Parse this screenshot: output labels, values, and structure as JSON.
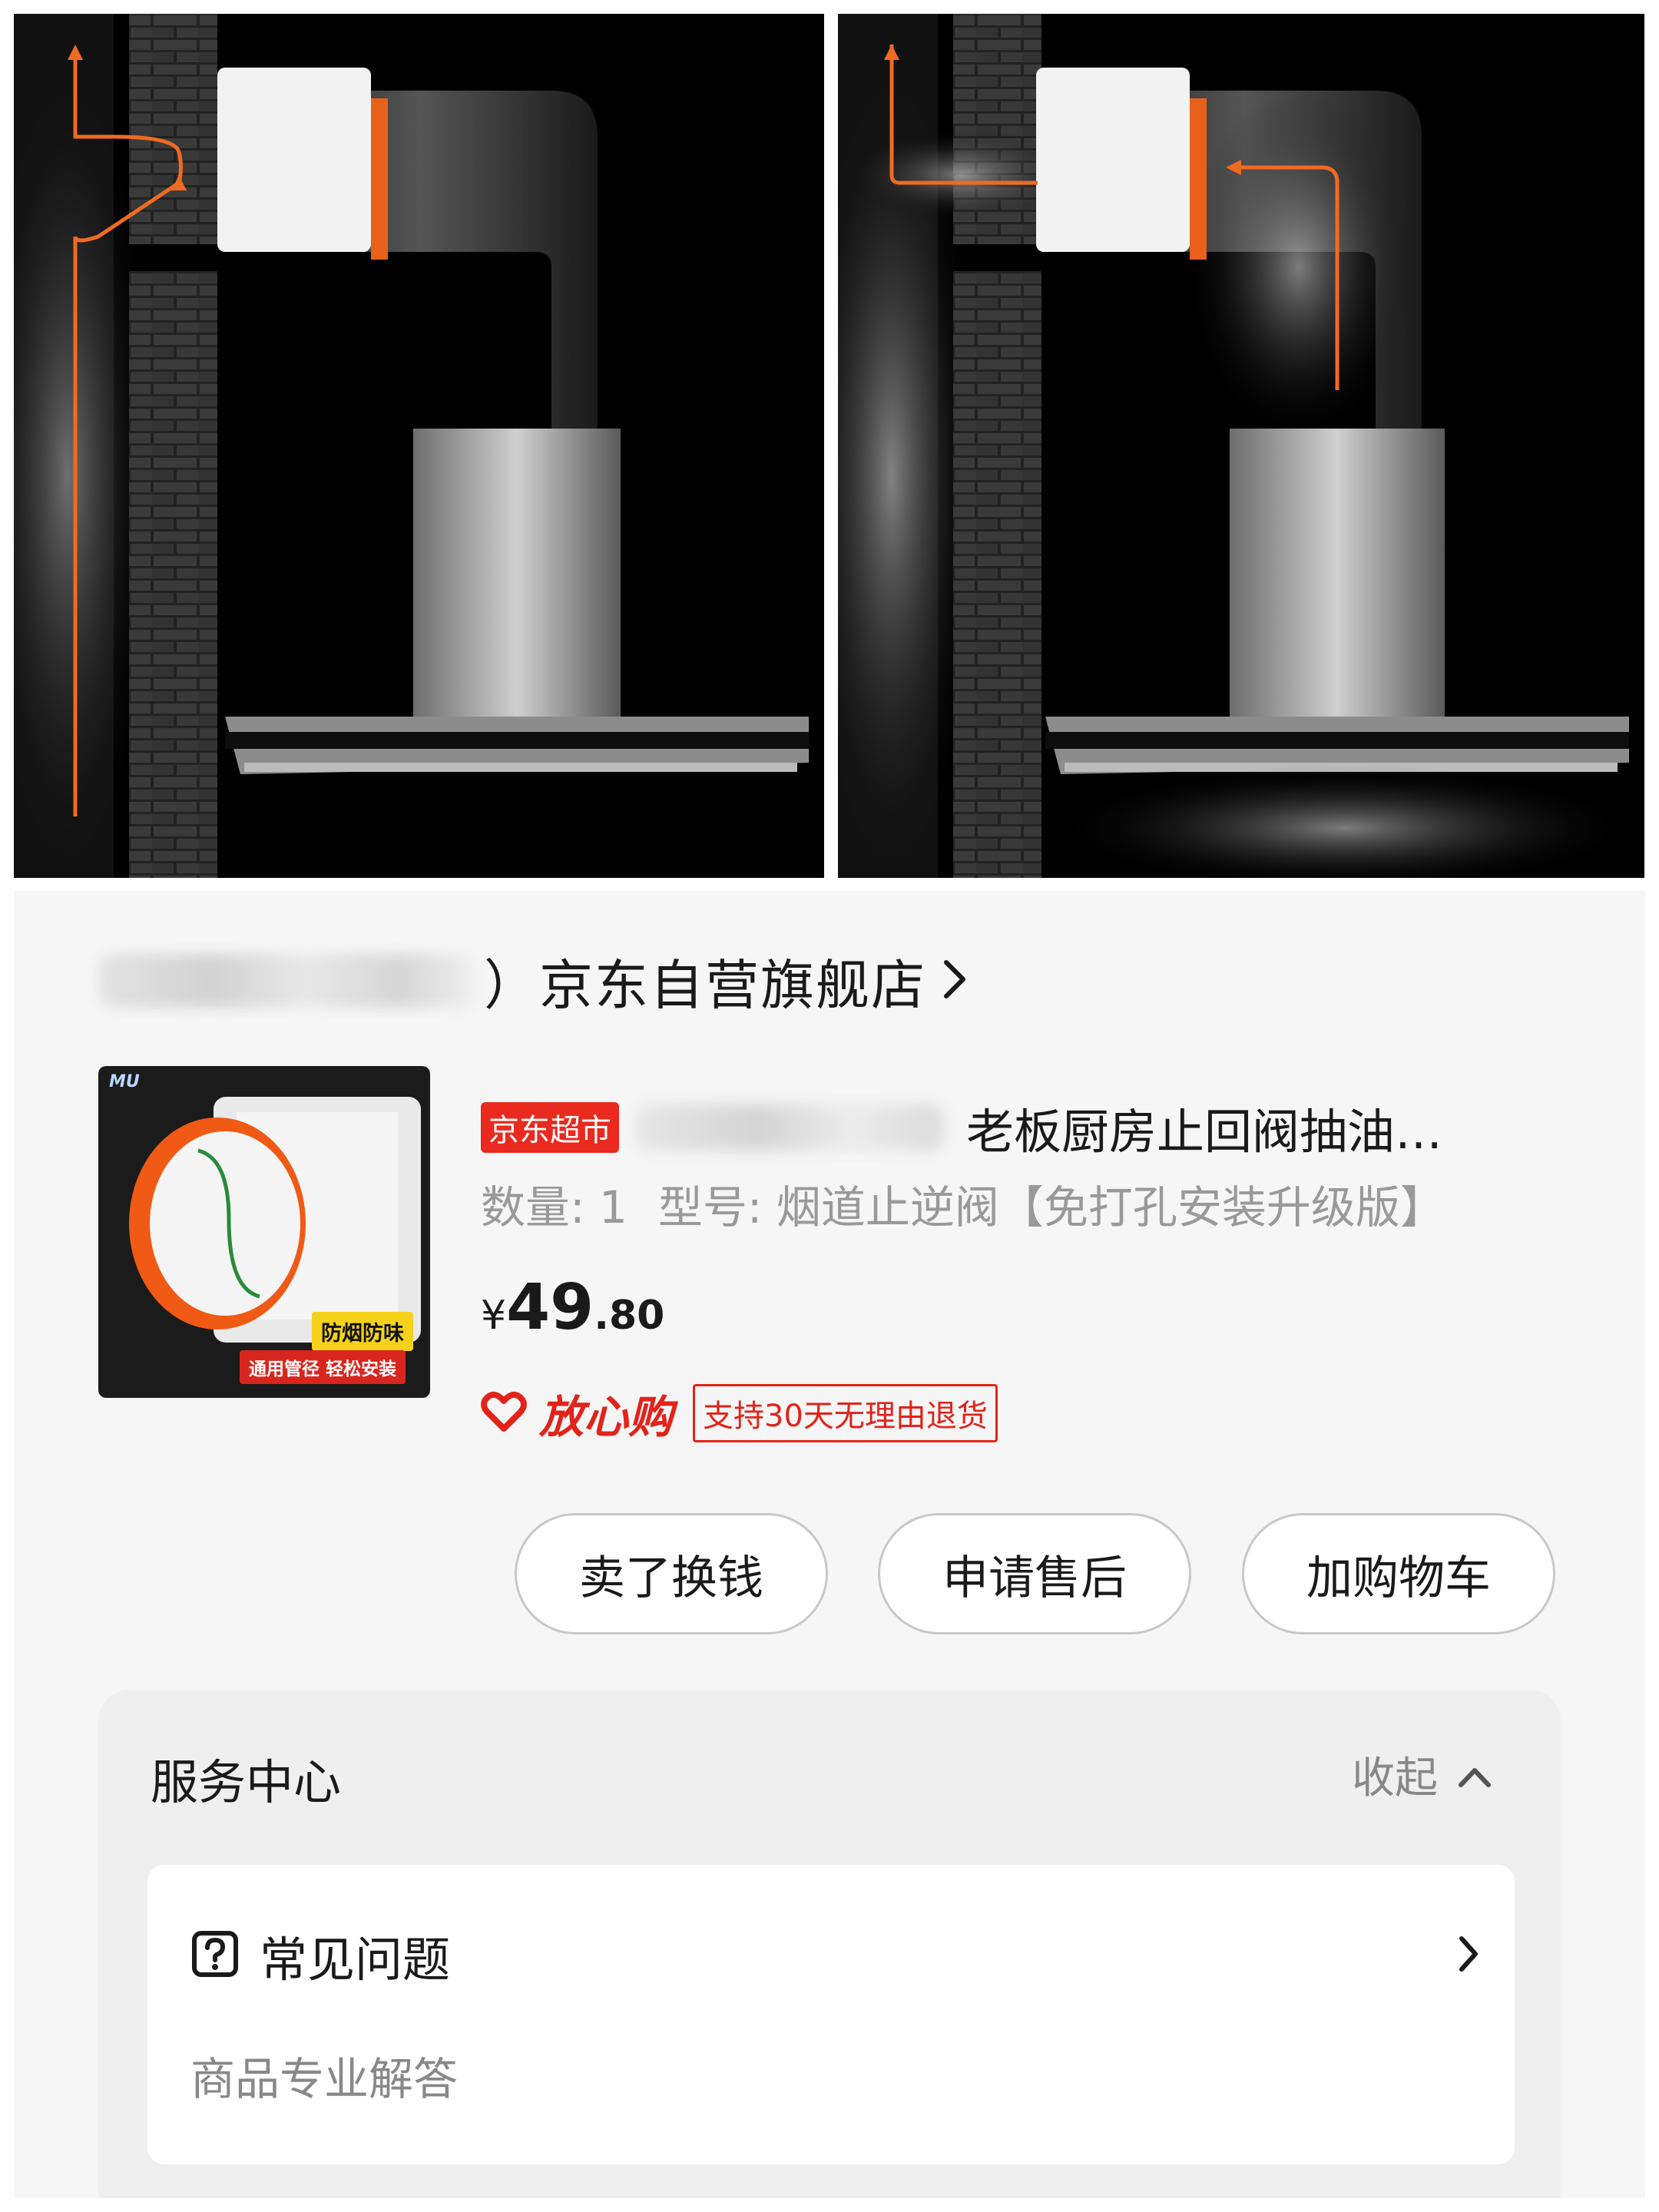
{
  "store": {
    "name": "）京东自营旗舰店"
  },
  "product": {
    "tag": "京东超市",
    "title": "老板厨房止回阀抽油…",
    "quantity": "数量: 1",
    "model": "型号: 烟道止逆阀【免打孔安装升级版】",
    "price_currency": "¥",
    "price_int": "49",
    "price_dec": ".80",
    "image_brand": "MU",
    "image_badge1": "防烟防味",
    "image_badge2": "通用管径 轻松安装"
  },
  "assurance": {
    "label": "放心购",
    "return_policy": "支持30天无理由退货",
    "accent": "#e2231a"
  },
  "actions": {
    "sell": "卖了换钱",
    "after_sales": "申请售后",
    "add_cart": "加购物车"
  },
  "service": {
    "title": "服务中心",
    "collapse": "收起",
    "faq_label": "常见问题",
    "faq_sub": "商品专业解答"
  },
  "icons": {
    "illustration_left": "range-hood-without-check-valve",
    "illustration_right": "range-hood-smoke-backflow",
    "store_arrow": "chevron-right-icon",
    "heart": "heart-icon",
    "collapse": "chevron-up-icon",
    "faq": "question-box-icon",
    "faq_arrow": "chevron-right-icon"
  }
}
